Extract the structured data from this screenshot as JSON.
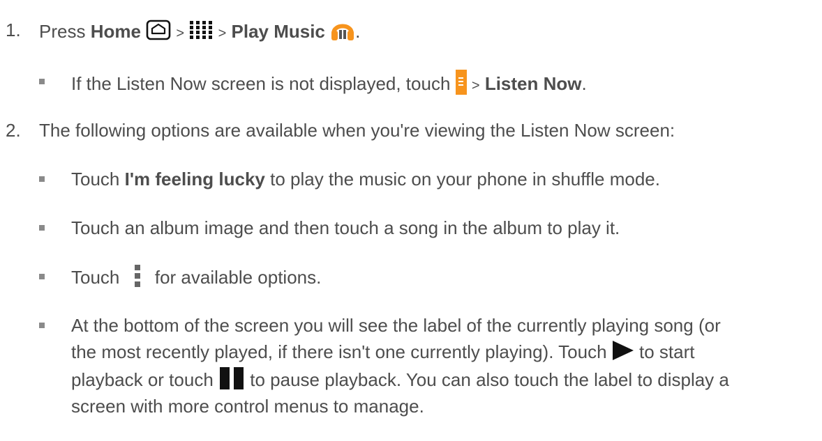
{
  "step1": {
    "number": "1.",
    "press": "Press",
    "home": "Home",
    "sep1": ">",
    "sep2": ">",
    "play_music": "Play Music",
    "end": ".",
    "icons": [
      "home-icon",
      "apps-grid-icon",
      "play-music-headphones-icon"
    ],
    "sub1": {
      "text_before": "If the Listen Now screen is not displayed, touch",
      "sep": ">",
      "listen_now": "Listen Now",
      "end": ".",
      "icon": "menu-tab-icon"
    }
  },
  "step2": {
    "number": "2.",
    "text": "The following options are available when you're viewing the Listen Now screen:",
    "bullets": {
      "b1_touch": "Touch",
      "b1_bold": "I'm feeling lucky",
      "b1_rest": "to play the music on your phone in shuffle mode.",
      "b2": "Touch an album image and then touch a song in the album to play it.",
      "b3_touch": "Touch",
      "b3_rest": "for available options.",
      "b4_line1": "At the bottom of the screen you will see the label of the currently playing song (or",
      "b4_line2_before": "the most recently played, if there isn't one currently playing). Touch",
      "b4_line2_after": "to start",
      "b4_line3_before": "playback or touch",
      "b4_line3_after": "to pause playback. You can also touch the label to display a",
      "b4_line4": "screen with more control menus to manage."
    },
    "icons": [
      "overflow-menu-icon",
      "play-icon",
      "pause-icon"
    ]
  }
}
